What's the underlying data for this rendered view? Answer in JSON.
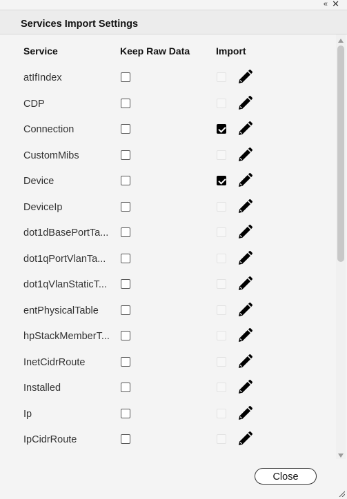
{
  "window": {
    "collapse_icon": "«",
    "close_icon": "✕",
    "title": "Services Import Settings"
  },
  "columns": {
    "service": "Service",
    "keep_raw": "Keep Raw Data",
    "import": "Import"
  },
  "services": [
    {
      "name": "atIfIndex",
      "keep_raw": false,
      "import_checked": false,
      "import_enabled": false
    },
    {
      "name": "CDP",
      "keep_raw": false,
      "import_checked": false,
      "import_enabled": false
    },
    {
      "name": "Connection",
      "keep_raw": false,
      "import_checked": true,
      "import_enabled": true
    },
    {
      "name": "CustomMibs",
      "keep_raw": false,
      "import_checked": false,
      "import_enabled": false
    },
    {
      "name": "Device",
      "keep_raw": false,
      "import_checked": true,
      "import_enabled": true
    },
    {
      "name": "DeviceIp",
      "keep_raw": false,
      "import_checked": false,
      "import_enabled": false
    },
    {
      "name": "dot1dBasePortTa...",
      "keep_raw": false,
      "import_checked": false,
      "import_enabled": false
    },
    {
      "name": "dot1qPortVlanTa...",
      "keep_raw": false,
      "import_checked": false,
      "import_enabled": false
    },
    {
      "name": "dot1qVlanStaticT...",
      "keep_raw": false,
      "import_checked": false,
      "import_enabled": false
    },
    {
      "name": "entPhysicalTable",
      "keep_raw": false,
      "import_checked": false,
      "import_enabled": false
    },
    {
      "name": "hpStackMemberT...",
      "keep_raw": false,
      "import_checked": false,
      "import_enabled": false
    },
    {
      "name": "InetCidrRoute",
      "keep_raw": false,
      "import_checked": false,
      "import_enabled": false
    },
    {
      "name": "Installed",
      "keep_raw": false,
      "import_checked": false,
      "import_enabled": false
    },
    {
      "name": "Ip",
      "keep_raw": false,
      "import_checked": false,
      "import_enabled": false
    },
    {
      "name": "IpCidrRoute",
      "keep_raw": false,
      "import_checked": false,
      "import_enabled": false
    }
  ],
  "icons": {
    "edit": "pencil-icon",
    "collapse": "double-chevron-left-icon",
    "close": "close-icon"
  },
  "footer": {
    "close_label": "Close"
  }
}
